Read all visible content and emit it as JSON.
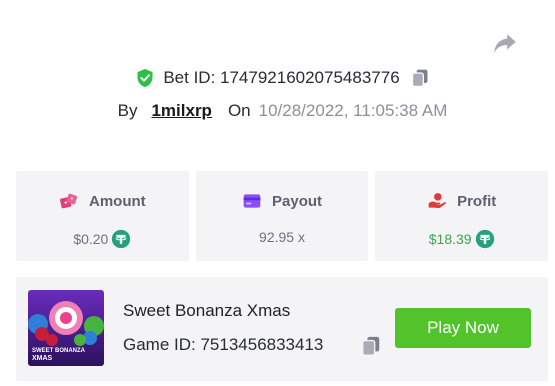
{
  "header": {
    "bet_id": "Bet ID: 1747921602075483776",
    "by_label": "By",
    "username": "1milxrp",
    "on_label": "On",
    "date": "10/28/2022, 11:05:38 AM"
  },
  "stats": {
    "amount": {
      "label": "Amount",
      "value": "$0.20"
    },
    "payout": {
      "label": "Payout",
      "value": "92.95 x"
    },
    "profit": {
      "label": "Profit",
      "value": "$18.39"
    }
  },
  "game": {
    "name": "Sweet Bonanza Xmas",
    "game_id": "Game ID: 7513456833413",
    "thumb_text_1": "SWEET BONANZA",
    "thumb_text_2": "XMAS",
    "play_label": "Play Now"
  },
  "colors": {
    "accent_green": "#52c32b",
    "profit_green": "#3aa84a",
    "tether": "#26a17b",
    "shield": "#2fbf47",
    "amount_icon": "#e0407a",
    "payout_icon": "#8a4dff",
    "profit_icon": "#e23a3a"
  },
  "icons": {
    "share": "share-arrow-icon",
    "verified": "shield-check-icon",
    "copy": "copy-icon",
    "amount": "dice-icon",
    "payout": "card-icon",
    "profit": "hand-money-icon",
    "currency": "tether-coin-icon"
  }
}
